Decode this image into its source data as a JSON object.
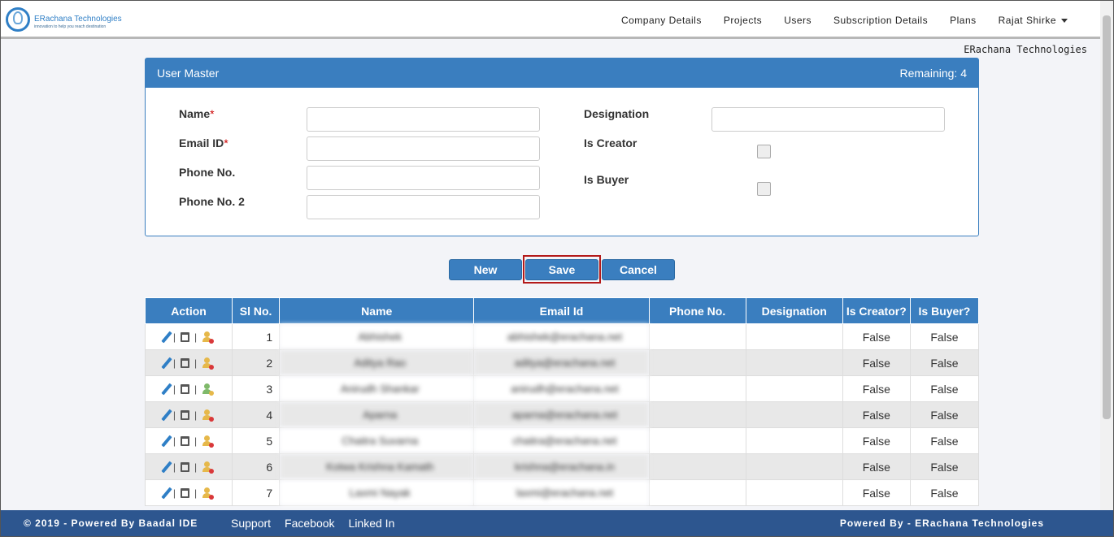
{
  "brand": {
    "name": "ERachana Technologies",
    "tagline": "innovation to help you reach destination"
  },
  "nav": {
    "items": [
      "Company Details",
      "Projects",
      "Users",
      "Subscription Details",
      "Plans"
    ],
    "user": "Rajat Shirke"
  },
  "company_name": "ERachana Technologies",
  "panel": {
    "title": "User Master",
    "remaining": "Remaining: 4",
    "fields": {
      "name": "Name",
      "email": "Email ID",
      "phone": "Phone No.",
      "phone2": "Phone No. 2",
      "designation": "Designation",
      "is_creator": "Is Creator",
      "is_buyer": "Is Buyer",
      "required_mark": "*"
    }
  },
  "buttons": {
    "new": "New",
    "save": "Save",
    "cancel": "Cancel"
  },
  "table": {
    "headers": [
      "Action",
      "Sl No.",
      "Name",
      "Email Id",
      "Phone No.",
      "Designation",
      "Is Creator?",
      "Is Buyer?"
    ],
    "rows": [
      {
        "sl": "1",
        "name": "Abhishek",
        "email": "abhishek@erachana.net",
        "phone": "",
        "designation": "",
        "creator": "False",
        "buyer": "False"
      },
      {
        "sl": "2",
        "name": "Aditya Rao",
        "email": "aditya@erachana.net",
        "phone": "",
        "designation": "",
        "creator": "False",
        "buyer": "False"
      },
      {
        "sl": "3",
        "name": "Anirudh Shankar",
        "email": "anirudh@erachana.net",
        "phone": "",
        "designation": "",
        "creator": "False",
        "buyer": "False"
      },
      {
        "sl": "4",
        "name": "Aparna",
        "email": "aparna@erachana.net",
        "phone": "",
        "designation": "",
        "creator": "False",
        "buyer": "False"
      },
      {
        "sl": "5",
        "name": "Chaitra Suvarna",
        "email": "chaitra@erachana.net",
        "phone": "",
        "designation": "",
        "creator": "False",
        "buyer": "False"
      },
      {
        "sl": "6",
        "name": "Kotwa Krishna Kamath",
        "email": "krishna@erachana.in",
        "phone": "",
        "designation": "",
        "creator": "False",
        "buyer": "False"
      },
      {
        "sl": "7",
        "name": "Laxmi Nayak",
        "email": "laxmi@erachana.net",
        "phone": "",
        "designation": "",
        "creator": "False",
        "buyer": "False"
      }
    ]
  },
  "footer": {
    "left": "© 2019 - Powered By Baadal IDE",
    "links": [
      "Support",
      "Facebook",
      "Linked In"
    ],
    "right": "Powered By - ERachana Technologies"
  }
}
